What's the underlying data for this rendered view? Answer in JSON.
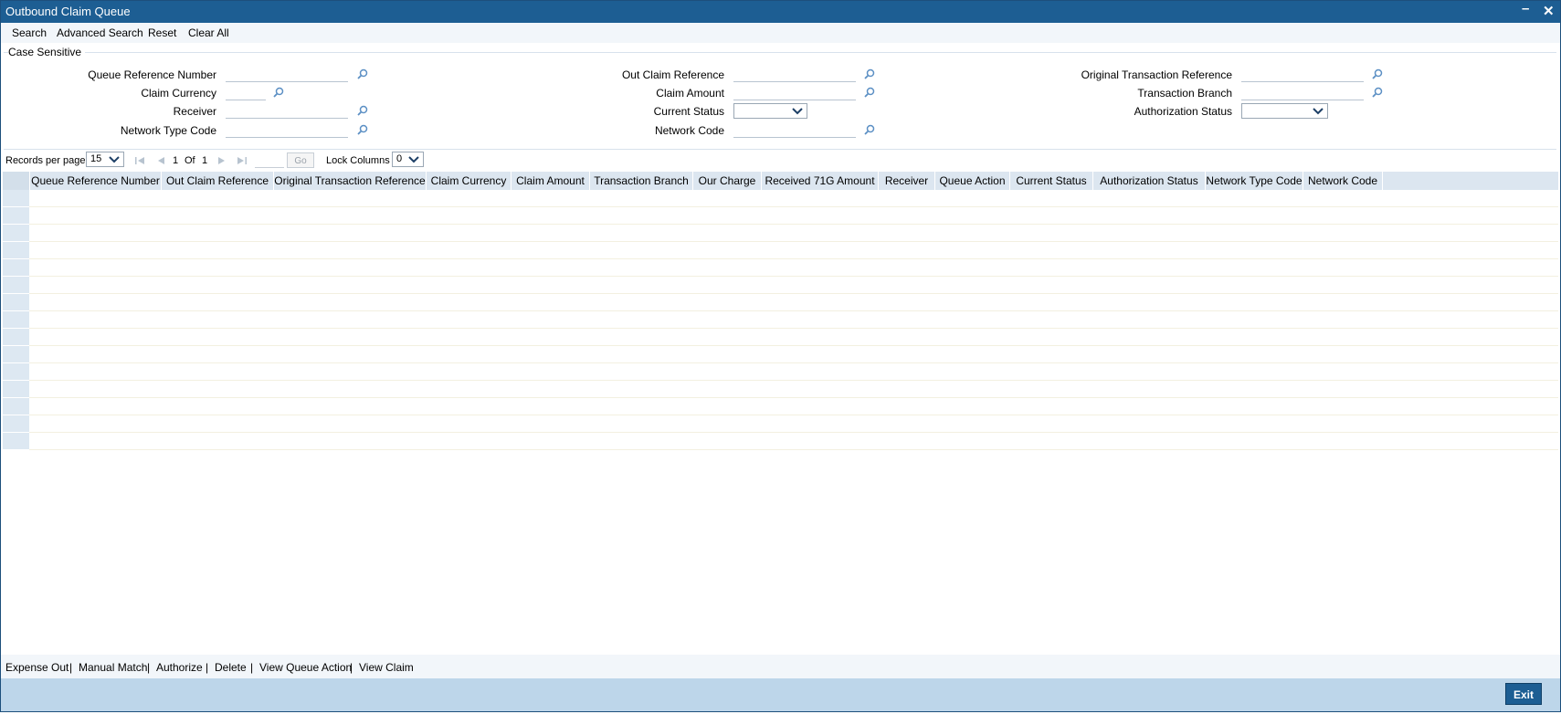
{
  "window": {
    "title": "Outbound Claim Queue"
  },
  "toolbar": {
    "search": "Search",
    "advanced_search": "Advanced Search",
    "reset": "Reset",
    "clear_all": "Clear All"
  },
  "criteria": {
    "legend": "Case Sensitive",
    "queue_reference_number": {
      "label": "Queue Reference Number",
      "value": ""
    },
    "claim_currency": {
      "label": "Claim Currency",
      "value": ""
    },
    "receiver": {
      "label": "Receiver",
      "value": ""
    },
    "network_type_code": {
      "label": "Network Type Code",
      "value": ""
    },
    "out_claim_reference": {
      "label": "Out Claim Reference",
      "value": ""
    },
    "claim_amount": {
      "label": "Claim Amount",
      "value": ""
    },
    "current_status": {
      "label": "Current Status",
      "value": ""
    },
    "network_code": {
      "label": "Network Code",
      "value": ""
    },
    "original_transaction_reference": {
      "label": "Original Transaction Reference",
      "value": ""
    },
    "transaction_branch": {
      "label": "Transaction Branch",
      "value": ""
    },
    "authorization_status": {
      "label": "Authorization Status",
      "value": ""
    }
  },
  "pager": {
    "records_per_page_label": "Records per page",
    "records_per_page": "15",
    "current_page": "1",
    "of_label": "Of",
    "total_pages": "1",
    "go_label": "Go",
    "lock_columns_label": "Lock Columns",
    "lock_columns": "0"
  },
  "grid": {
    "columns": [
      "Queue Reference Number",
      "Out Claim Reference",
      "Original Transaction Reference",
      "Claim Currency",
      "Claim Amount",
      "Transaction Branch",
      "Our Charge",
      "Received 71G Amount",
      "Receiver",
      "Queue Action",
      "Current Status",
      "Authorization Status",
      "Network Type Code",
      "Network Code"
    ],
    "empty_rows": 15
  },
  "actions": {
    "expense_out": "Expense Out",
    "manual_match": "Manual Match",
    "authorize": "Authorize",
    "delete": "Delete",
    "view_queue_action": "View Queue Action",
    "view_claim": "View Claim",
    "separator": "|"
  },
  "footer": {
    "exit": "Exit"
  },
  "colors": {
    "title_bar": "#1d5e93",
    "grid_header": "#dce6f0",
    "footer_bar": "#bdd6ea",
    "lookup_icon": "#5b8fc4"
  }
}
